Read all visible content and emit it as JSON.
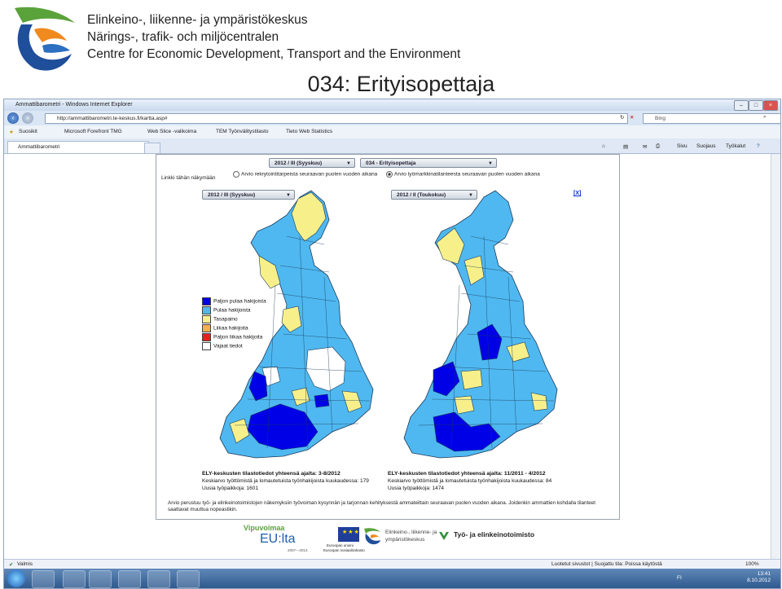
{
  "header": {
    "org_fi": "Elinkeino-, liikenne- ja ympäristökeskus",
    "org_sv": "Närings-, trafik- och miljöcentralen",
    "org_en": "Centre for Economic Development, Transport and the Environment",
    "logo_icon": "ely-logo-icon"
  },
  "slide_title": "034: Erityisopettaja",
  "browser": {
    "title": "Ammattibarometri - Windows Internet Explorer",
    "url": "http://ammattibarometri.te-keskus.fi/kartta.asp#",
    "search_engine": "Bing",
    "favorites": [
      "Suosikit",
      "Microsoft Forefront TMG",
      "Web Slice -valikoima",
      "TEM Työnvälitystilasto",
      "Tieto Web Statistics"
    ],
    "tab_label": "Ammattibarometri",
    "commands": [
      "Sivu",
      "Suojaus",
      "Työkalut"
    ],
    "status_left": "Valmis",
    "status_zone": "Luotetut sivustot | Suojattu tila: Poissa käytöstä",
    "zoom": "100%",
    "clock_time": "13:41",
    "clock_date": "8.10.2012",
    "lang": "FI"
  },
  "page": {
    "top_period": "2012 / III (Syyskuu)",
    "top_occupation": "034 - Erityisopettaja",
    "link_label": "Linkki tähän näkymään",
    "radio_1": "Arvio rekrytointitarpeista seuraavan puolen vuoden aikana",
    "radio_2": "Arvio työmarkkinatilanteesta seuraavan puolen vuoden aikana",
    "left_period": "2012 / III (Syyskuu)",
    "right_period": "2012 / II (Toukokuu)",
    "close_label": "[X]",
    "legend": [
      {
        "label": "Paljon pulaa hakijoista",
        "color": "#0000e6"
      },
      {
        "label": "Pulaa hakijoista",
        "color": "#4fb8f0"
      },
      {
        "label": "Tasapaino",
        "color": "#f7f08a"
      },
      {
        "label": "Liikaa hakijoita",
        "color": "#f5b04a"
      },
      {
        "label": "Paljon liikaa hakijoita",
        "color": "#e6201e"
      },
      {
        "label": "Vajaat tiedot",
        "color": "#ffffff"
      }
    ],
    "left_stats": {
      "title": "ELY-keskusten tilastotiedot yhteensä ajalta: 3-8/2012",
      "line1": "Keskiarvo työttömistä ja lomautetuista työnhakijoista kuukaudessa: 179",
      "line2": "Uusia työpaikkoja: 1601"
    },
    "right_stats": {
      "title": "ELY-keskusten tilastotiedot yhteensä ajalta: 11/2011 - 4/2012",
      "line1": "Keskiarvo työttömistä ja lomautetuista työnhakijoista kuukaudessa: 84",
      "line2": "Uusia työpaikkoja: 1474"
    },
    "footnote": "Arvio perustuu työ- ja elinkeinotoimistojen näkemyksiin työvoiman kysynnän ja tarjonnan kehityksestä ammateittain seuraavan puolen vuoden aikana. Joidenkin ammattien kohdalla tilanteet saattavat muuttua nopeastikin."
  },
  "footer": {
    "vipuvoimaa": "Vipuvoimaa",
    "eu_lta": "EU:lta",
    "eu_years": "2007—2013",
    "eu_union": "Euroopan unioni",
    "eu_fund": "Euroopan sosiaalirahasto",
    "ely_fi": "Elinkeino-, liikenne- ja",
    "ely_fi2": "ympäristökeskus",
    "te_label": "Työ- ja elinkeinotoimisto"
  }
}
